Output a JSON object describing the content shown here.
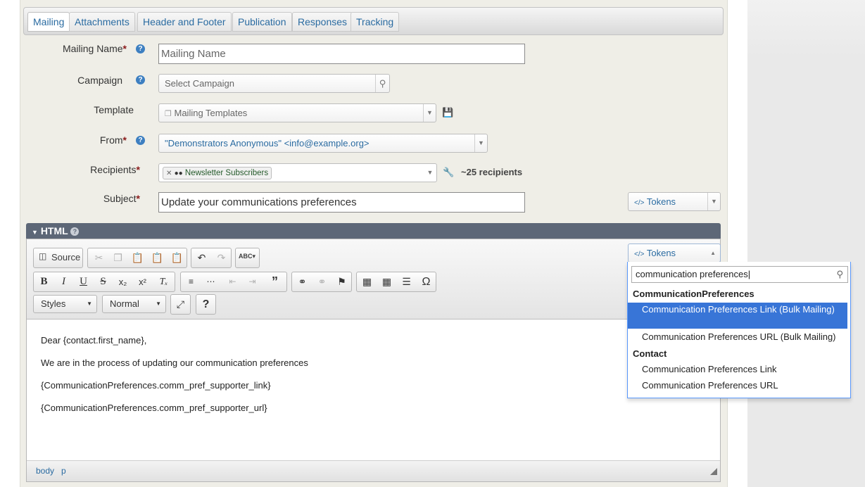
{
  "tabs": [
    {
      "label": "Mailing",
      "active": true
    },
    {
      "label": "Attachments",
      "active": false
    },
    {
      "label": "Header and Footer",
      "active": false
    },
    {
      "label": "Publication",
      "active": false
    },
    {
      "label": "Responses",
      "active": false
    },
    {
      "label": "Tracking",
      "active": false
    }
  ],
  "form": {
    "mailing_name_label": "Mailing Name",
    "mailing_name_placeholder": "Mailing Name",
    "campaign_label": "Campaign",
    "campaign_placeholder": "Select Campaign",
    "template_label": "Template",
    "template_placeholder": "Mailing Templates",
    "from_label": "From",
    "from_value": "\"Demonstrators Anonymous\" <info@example.org>",
    "recipients_label": "Recipients",
    "recipients_chip": "Newsletter Subscribers",
    "recipients_count": "~25 recipients",
    "subject_label": "Subject",
    "subject_value": "Update your communications preferences",
    "tokens_label": "Tokens",
    "required_mark": "*",
    "help_mark": "?"
  },
  "html_section": {
    "title": "HTML",
    "tokens_label": "Tokens",
    "source_label": "Source",
    "styles_label": "Styles",
    "format_label": "Normal",
    "content": [
      "Dear {contact.first_name},",
      "We are in the process of updating our communication preferences",
      "{CommunicationPreferences.comm_pref_supporter_link}",
      "{CommunicationPreferences.comm_pref_supporter_url}"
    ],
    "status_path": [
      "body",
      "p"
    ]
  },
  "tokens_dropdown": {
    "search_value": "communication preferences",
    "groups": [
      {
        "name": "CommunicationPreferences",
        "items": [
          {
            "label": "Communication Preferences Link (Bulk Mailing)",
            "highlighted": true
          },
          {
            "label": "Communication Preferences URL (Bulk Mailing)",
            "highlighted": false
          }
        ]
      },
      {
        "name": "Contact",
        "items": [
          {
            "label": "Communication Preferences Link",
            "highlighted": false
          },
          {
            "label": "Communication Preferences URL",
            "highlighted": false
          }
        ]
      }
    ]
  },
  "colors": {
    "link_blue": "#2a6ba1",
    "highlight": "#3875d7",
    "section_header": "#5d6777",
    "panel_bg": "#efeee7"
  }
}
